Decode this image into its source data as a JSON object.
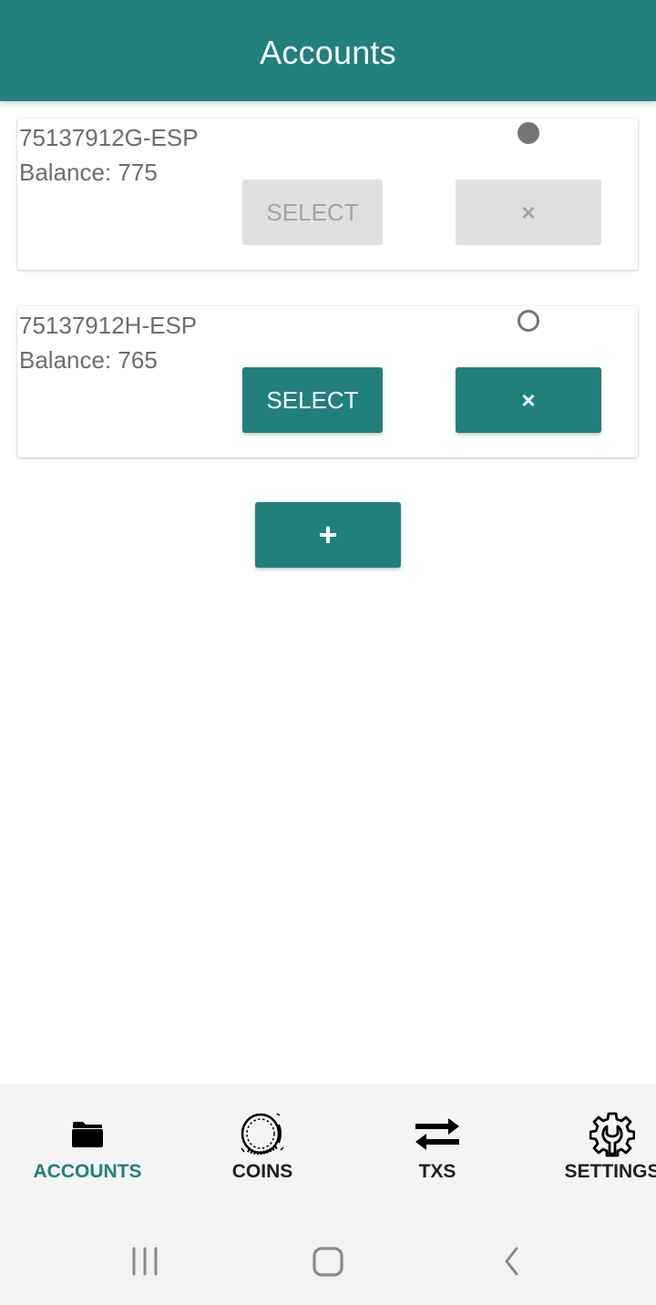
{
  "app_bar": {
    "title": "Accounts"
  },
  "accounts": [
    {
      "id": "75137912G-ESP",
      "balance_text": "Balance: 775",
      "balance": 775,
      "selected": true,
      "select_label": "SELECT",
      "select_enabled": false,
      "delete_icon": "×",
      "delete_enabled": false
    },
    {
      "id": "75137912H-ESP",
      "balance_text": "Balance: 765",
      "balance": 765,
      "selected": false,
      "select_label": "SELECT",
      "select_enabled": true,
      "delete_icon": "×",
      "delete_enabled": true
    }
  ],
  "add_button": {
    "icon": "+"
  },
  "bottom_nav": {
    "active": "ACCOUNTS",
    "items": [
      {
        "label": "ACCOUNTS",
        "icon": "folder-icon"
      },
      {
        "label": "COINS",
        "icon": "coin-icon"
      },
      {
        "label": "TXS",
        "icon": "transfer-arrows-icon"
      },
      {
        "label": "SETTINGS",
        "icon": "gear-wrench-icon"
      }
    ]
  },
  "system_nav": {
    "buttons": [
      "recent-apps",
      "home",
      "back"
    ]
  },
  "colors": {
    "primary": "#21807c",
    "disabled_bg": "#dfdfdf",
    "disabled_text": "#a5a5a5",
    "text_secondary": "#6d6d6d",
    "nav_bg": "#f4f4f4"
  }
}
